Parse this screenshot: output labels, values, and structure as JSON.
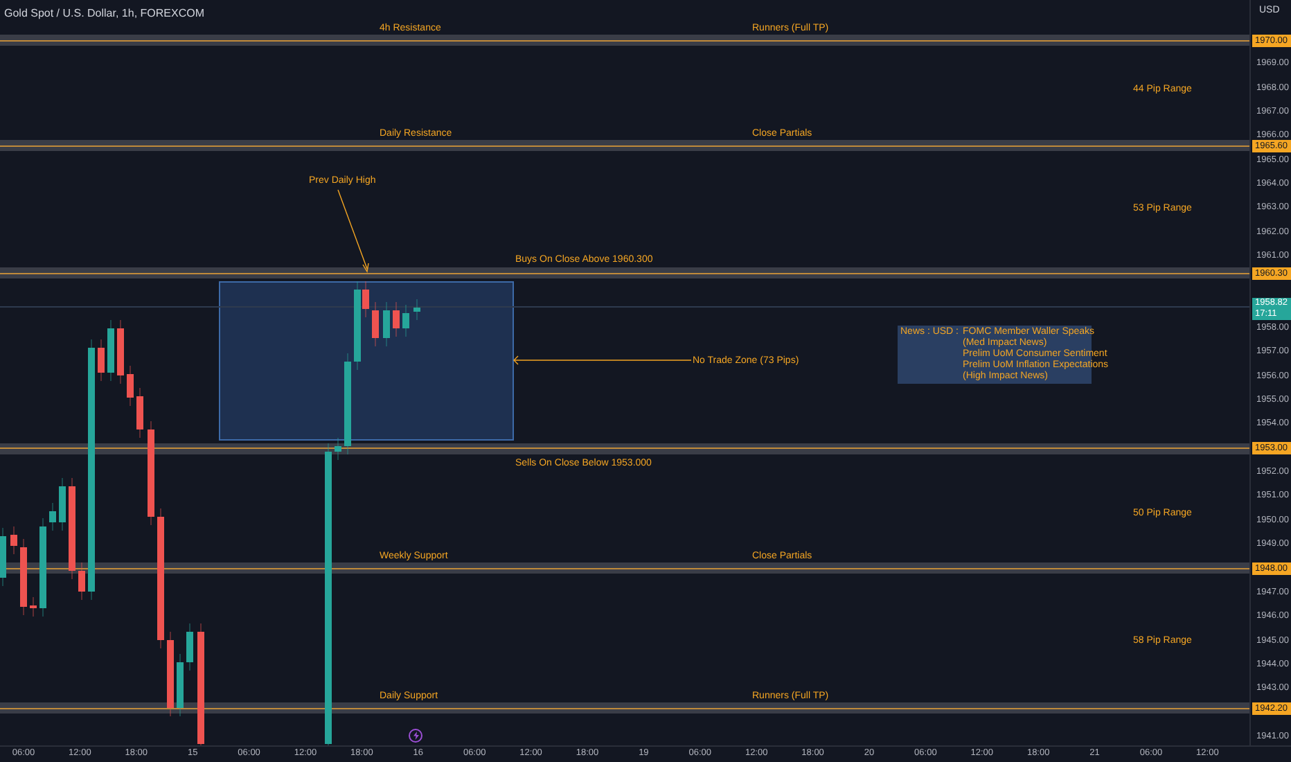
{
  "header": {
    "title": "Gold Spot / U.S. Dollar, 1h, FOREXCOM"
  },
  "price_axis": {
    "currency": "USD",
    "ticks": [
      "1969.00",
      "1968.00",
      "1967.00",
      "1966.00",
      "1965.00",
      "1964.00",
      "1963.00",
      "1962.00",
      "1961.00",
      "1958.00",
      "1957.00",
      "1956.00",
      "1955.00",
      "1954.00",
      "1952.00",
      "1951.00",
      "1950.00",
      "1949.00",
      "1947.00",
      "1946.00",
      "1945.00",
      "1944.00",
      "1943.00",
      "1941.00"
    ],
    "current_price": {
      "price": "1958.82",
      "countdown": "17:11"
    }
  },
  "levels": [
    {
      "price": "1970.00",
      "labels": [
        {
          "text": "4h Resistance",
          "kind": "left"
        },
        {
          "text": "Runners (Full TP)",
          "kind": "right"
        }
      ]
    },
    {
      "price": "1965.60",
      "labels": [
        {
          "text": "Daily Resistance",
          "kind": "left"
        },
        {
          "text": "Close Partials",
          "kind": "right"
        }
      ]
    },
    {
      "price": "1960.30",
      "labels": [
        {
          "text": "Buys On Close Above 1960.300",
          "kind": "above"
        }
      ]
    },
    {
      "price": "1953.00",
      "labels": [
        {
          "text": "Sells On Close Below 1953.000",
          "kind": "below"
        }
      ]
    },
    {
      "price": "1948.00",
      "labels": [
        {
          "text": "Weekly Support",
          "kind": "left"
        },
        {
          "text": "Close Partials",
          "kind": "right"
        }
      ]
    },
    {
      "price": "1942.20",
      "labels": [
        {
          "text": "Daily Support",
          "kind": "left"
        },
        {
          "text": "Runners (Full TP)",
          "kind": "right"
        }
      ]
    }
  ],
  "ranges": [
    "44 Pip Range",
    "53 Pip Range",
    "50 Pip Range",
    "58 Pip Range"
  ],
  "prev_daily_high": {
    "label": "Prev Daily High"
  },
  "no_trade_zone": {
    "label": "No Trade Zone (73 Pips)"
  },
  "news": {
    "prefix": "News : USD :",
    "lines": [
      "FOMC Member Waller Speaks",
      "(Med Impact News)",
      "Prelim UoM Consumer Sentiment",
      "Prelim UoM Inflation Expectations",
      "(High Impact News)"
    ]
  },
  "time_axis": [
    "06:00",
    "12:00",
    "18:00",
    "15",
    "06:00",
    "12:00",
    "18:00",
    "16",
    "06:00",
    "12:00",
    "18:00",
    "19",
    "06:00",
    "12:00",
    "18:00",
    "20",
    "06:00",
    "12:00",
    "18:00",
    "21",
    "06:00",
    "12:00"
  ]
}
